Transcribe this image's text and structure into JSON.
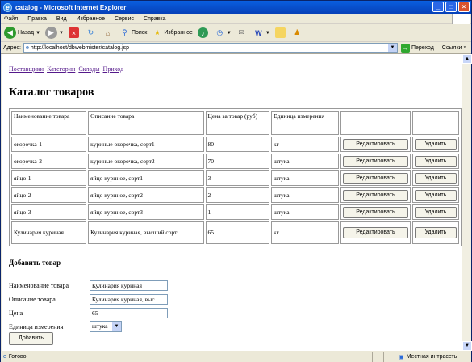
{
  "window": {
    "title": "catalog - Microsoft Internet Explorer",
    "minimize": "_",
    "maximize": "□",
    "close": "×"
  },
  "menu": [
    "Файл",
    "Правка",
    "Вид",
    "Избранное",
    "Сервис",
    "Справка"
  ],
  "toolbar": {
    "back_label": "Назад",
    "search_label": "Поиск",
    "favorites_label": "Избранное"
  },
  "address": {
    "label": "Адрес:",
    "url": "http://localhost/dbwebmister/catalog.jsp",
    "go_label": "Переход",
    "links_label": "Ссылки"
  },
  "nav": [
    "Поставщики",
    "Категории",
    "Склады",
    "Приход"
  ],
  "page": {
    "title": "Каталог товаров"
  },
  "table": {
    "headers": [
      "Наименование товара",
      "Описание товара",
      "Цена за товар (руб)",
      "Единица измерения"
    ],
    "rows": [
      {
        "name": "окорочка-1",
        "desc": "куриные окорочка, сорт1",
        "price": "80",
        "unit": "кг"
      },
      {
        "name": "окорочка-2",
        "desc": "куриные окорочка, сорт2",
        "price": "70",
        "unit": "штука"
      },
      {
        "name": "яйцо-1",
        "desc": "яйцо куриное, сорт1",
        "price": "3",
        "unit": "штука"
      },
      {
        "name": "яйцо-2",
        "desc": "яйцо куриное, сорт2",
        "price": "2",
        "unit": "штука"
      },
      {
        "name": "яйцо-3",
        "desc": "яйцо куриное, сорт3",
        "price": "1",
        "unit": "штука"
      },
      {
        "name": "Кулинария куриная",
        "desc": "Кулинария куриная, высший сорт",
        "price": "65",
        "unit": "кг"
      }
    ],
    "edit_label": "Редактировать",
    "delete_label": "Удалить"
  },
  "add_form": {
    "title": "Добавить товар",
    "name_label": "Наименование товара",
    "name_value": "Кулинария куриная",
    "desc_label": "Описание товара",
    "desc_value": "Кулинария куриная, выс",
    "price_label": "Цена",
    "price_value": "65",
    "unit_label": "Единица измерения",
    "unit_value": "штука",
    "submit_label": "Добавить"
  },
  "status": {
    "text": "Готово",
    "zone": "Местная интрасеть"
  }
}
